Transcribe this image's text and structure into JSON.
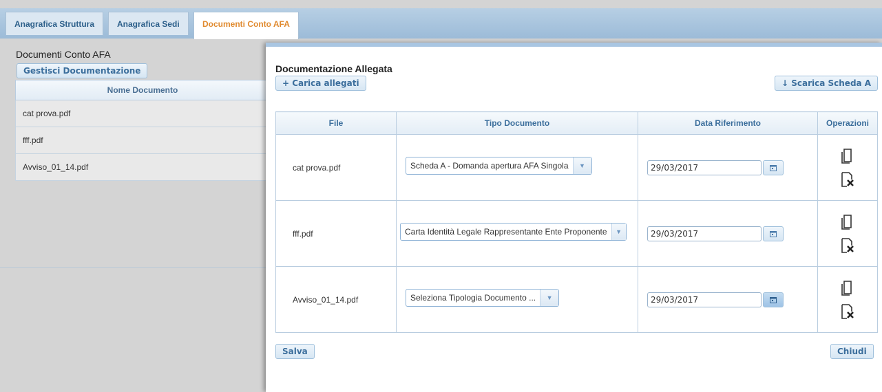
{
  "tabs": [
    {
      "label": "Anagrafica Struttura"
    },
    {
      "label": "Anagrafica Sedi"
    },
    {
      "label": "Documenti Conto AFA"
    }
  ],
  "background": {
    "title": "Documenti Conto AFA",
    "manage_button": "Gestisci Documentazione",
    "column_header": "Nome Documento",
    "rows": [
      "cat prova.pdf",
      "fff.pdf",
      "Avviso_01_14.pdf"
    ]
  },
  "dialog": {
    "title": "Documentazione Allegata",
    "upload_button": "+ Carica allegati",
    "download_button": "↓ Scarica Scheda A",
    "columns": [
      "File",
      "Tipo Documento",
      "Data Riferimento",
      "Operazioni"
    ],
    "rows": [
      {
        "file": "cat prova.pdf",
        "tipo": "Scheda A - Domanda apertura AFA Singola",
        "data": "29/03/2017"
      },
      {
        "file": "fff.pdf",
        "tipo": "Carta Identità Legale Rappresentante Ente Proponente",
        "data": "29/03/2017"
      },
      {
        "file": "Avviso_01_14.pdf",
        "tipo": "Seleziona Tipologia Documento ...",
        "data": "29/03/2017"
      }
    ],
    "save_button": "Salva",
    "close_button": "Chiudi"
  },
  "icons": {
    "dropdown_arrow": "chevron-down-icon",
    "calendar": "calendar-icon",
    "copy": "copy-document-icon",
    "delete": "delete-document-icon"
  },
  "colors": {
    "accent": "#3b6e9c",
    "active_tab": "#e08a2f",
    "tab_bar": "#9cbbd8"
  }
}
